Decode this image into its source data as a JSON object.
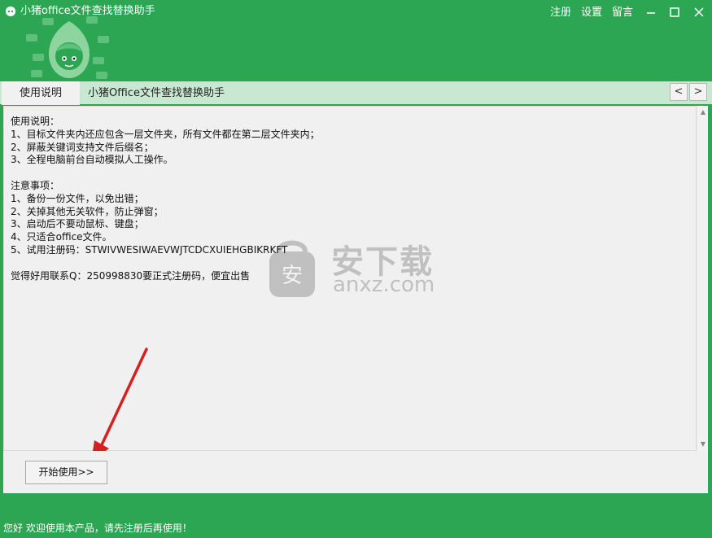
{
  "window": {
    "title": "小猪office文件查找替换助手",
    "links": [
      "注册",
      "设置",
      "留言"
    ],
    "controls": [
      "minimize",
      "maximize",
      "close"
    ]
  },
  "tabs": {
    "active_label": "使用说明",
    "title": "小猪Office文件查找替换助手",
    "prev": "<",
    "next": ">"
  },
  "instructions": {
    "lines": [
      "使用说明：",
      "1、目标文件夹内还应包含一层文件夹，所有文件都在第二层文件夹内；",
      "2、屏蔽关键词支持文件后缀名；",
      "3、全程电脑前台自动模拟人工操作。",
      "",
      "注意事项：",
      "1、备份一份文件，以免出错；",
      "2、关掉其他无关软件，防止弹窗；",
      "3、启动后不要动鼠标、键盘；",
      "4、只适合office文件。",
      "5、试用注册码：STWIVWESIWAEVWJTCDCXUIEHGBIKRKFT",
      "",
      "觉得好用联系Q：250998830要正式注册码，便宜出售"
    ]
  },
  "watermark": {
    "cn": "安下载",
    "en": "anxz.com",
    "shield_char": "安"
  },
  "start_button": "开始使用>>",
  "status": "您好 欢迎使用本产品，请先注册后再使用！",
  "colors": {
    "brand_green": "#2ca653",
    "tab_bg": "#c9e8d2",
    "arrow_red": "#d62020"
  }
}
